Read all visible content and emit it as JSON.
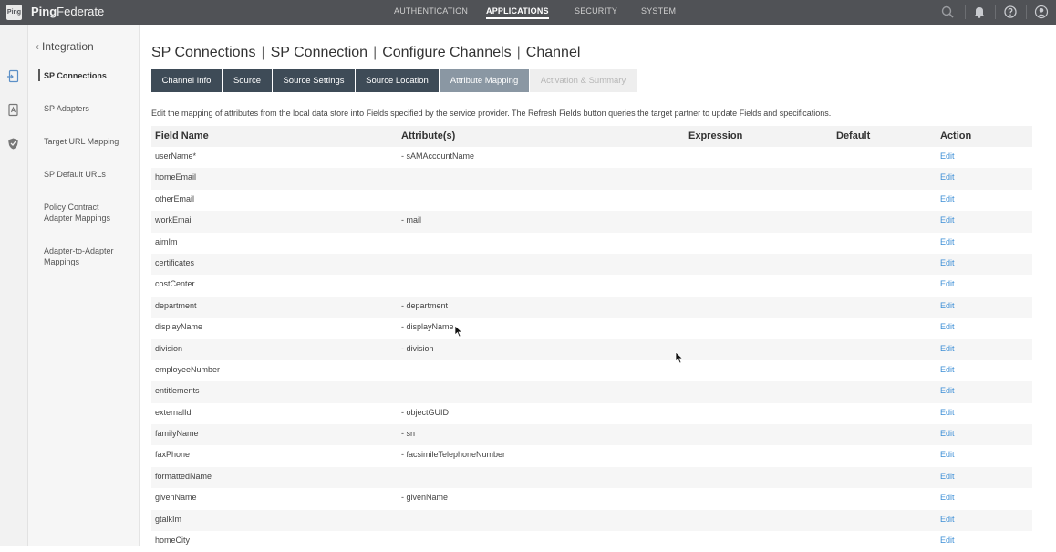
{
  "app": {
    "logo_text": "Ping",
    "brand_bold": "Ping",
    "brand_rest": "Federate"
  },
  "nav": {
    "items": [
      {
        "label": "AUTHENTICATION",
        "active": false
      },
      {
        "label": "APPLICATIONS",
        "active": true
      },
      {
        "label": "SECURITY",
        "active": false
      },
      {
        "label": "SYSTEM",
        "active": false
      }
    ]
  },
  "top_icons": [
    "search-icon",
    "bell-icon",
    "help-icon",
    "user-icon"
  ],
  "rail_icons": [
    "sp-connection-icon",
    "adapter-icon",
    "shield-icon"
  ],
  "sidebar": {
    "back_label": "Integration",
    "items": [
      {
        "label": "SP Connections",
        "active": true
      },
      {
        "label": "SP Adapters",
        "active": false
      },
      {
        "label": "Target URL Mapping",
        "active": false
      },
      {
        "label": "SP Default URLs",
        "active": false
      },
      {
        "label": "Policy Contract Adapter Mappings",
        "active": false
      },
      {
        "label": "Adapter-to-Adapter Mappings",
        "active": false
      }
    ]
  },
  "breadcrumb": [
    "SP Connections",
    "SP Connection",
    "Configure Channels",
    "Channel"
  ],
  "tabs": [
    {
      "label": "Channel Info",
      "state": "normal"
    },
    {
      "label": "Source",
      "state": "normal"
    },
    {
      "label": "Source Settings",
      "state": "normal"
    },
    {
      "label": "Source Location",
      "state": "normal"
    },
    {
      "label": "Attribute Mapping",
      "state": "active"
    },
    {
      "label": "Activation & Summary",
      "state": "disabled"
    }
  ],
  "description": "Edit the mapping of attributes from the local data store into Fields specified by the service provider. The Refresh Fields button queries the target partner to update Fields and specifications.",
  "table": {
    "headers": {
      "field": "Field Name",
      "attributes": "Attribute(s)",
      "expression": "Expression",
      "default": "Default",
      "action": "Action"
    },
    "rows": [
      {
        "field": "userName*",
        "attribute": "- sAMAccountName",
        "action": "Edit"
      },
      {
        "field": "homeEmail",
        "attribute": "",
        "action": "Edit"
      },
      {
        "field": "otherEmail",
        "attribute": "",
        "action": "Edit"
      },
      {
        "field": "workEmail",
        "attribute": "- mail",
        "action": "Edit"
      },
      {
        "field": "aimIm",
        "attribute": "",
        "action": "Edit"
      },
      {
        "field": "certificates",
        "attribute": "",
        "action": "Edit"
      },
      {
        "field": "costCenter",
        "attribute": "",
        "action": "Edit"
      },
      {
        "field": "department",
        "attribute": "- department",
        "action": "Edit"
      },
      {
        "field": "displayName",
        "attribute": "- displayName",
        "action": "Edit"
      },
      {
        "field": "division",
        "attribute": "- division",
        "action": "Edit"
      },
      {
        "field": "employeeNumber",
        "attribute": "",
        "action": "Edit"
      },
      {
        "field": "entitlements",
        "attribute": "",
        "action": "Edit"
      },
      {
        "field": "externalId",
        "attribute": "- objectGUID",
        "action": "Edit"
      },
      {
        "field": "familyName",
        "attribute": "- sn",
        "action": "Edit"
      },
      {
        "field": "faxPhone",
        "attribute": "- facsimileTelephoneNumber",
        "action": "Edit"
      },
      {
        "field": "formattedName",
        "attribute": "",
        "action": "Edit"
      },
      {
        "field": "givenName",
        "attribute": "- givenName",
        "action": "Edit"
      },
      {
        "field": "gtalkIm",
        "attribute": "",
        "action": "Edit"
      },
      {
        "field": "homeCity",
        "attribute": "",
        "action": "Edit"
      }
    ]
  }
}
